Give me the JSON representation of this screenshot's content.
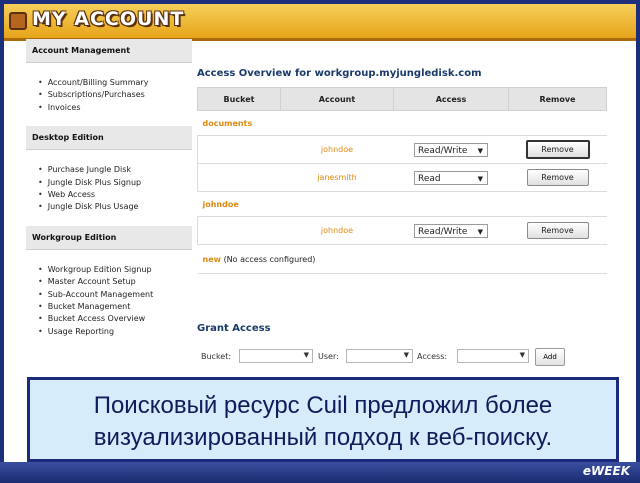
{
  "header": {
    "title": "MY ACCOUNT"
  },
  "sidebar": {
    "sections": [
      {
        "title": "Account Management",
        "items": [
          "Account/Billing Summary",
          "Subscriptions/Purchases",
          "Invoices"
        ]
      },
      {
        "title": "Desktop Edition",
        "items": [
          "Purchase Jungle Disk",
          "Jungle Disk Plus Signup",
          "Web Access",
          "Jungle Disk Plus Usage"
        ]
      },
      {
        "title": "Workgroup Edition",
        "items": [
          "Workgroup Edition Signup",
          "Master Account Setup",
          "Sub-Account Management",
          "Bucket Management",
          "Bucket Access Overview",
          "Usage Reporting"
        ]
      }
    ]
  },
  "main": {
    "title": "Access Overview for workgroup.myjungledisk.com",
    "columns": [
      "Bucket",
      "Account",
      "Access",
      "Remove"
    ],
    "groups": [
      {
        "name": "documents",
        "rows": [
          {
            "account": "johndoe",
            "access": "Read/Write",
            "remove": "Remove"
          },
          {
            "account": "janesmith",
            "access": "Read",
            "remove": "Remove"
          }
        ]
      },
      {
        "name": "johndoe",
        "rows": [
          {
            "account": "johndoe",
            "access": "Read/Write",
            "remove": "Remove"
          }
        ]
      }
    ],
    "new_row": {
      "link": "new",
      "note": "(No access configured)"
    }
  },
  "grant": {
    "title": "Grant Access",
    "bucket_label": "Bucket:",
    "user_label": "User:",
    "access_label": "Access:",
    "add_label": "Add"
  },
  "caption": {
    "line1": "Поисковый ресурс Cuil предложил более",
    "line2": "визуализированный подход к веб-поиску."
  },
  "brand": "eWEEK"
}
